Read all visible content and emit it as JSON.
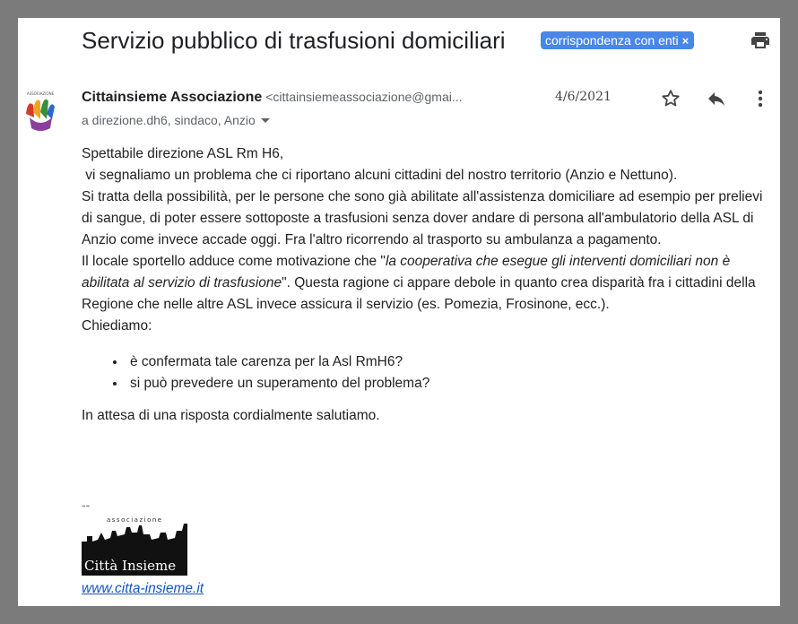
{
  "email": {
    "subject": "Servizio pubblico di trasfusioni domiciliari",
    "label": "corrispondenza con enti",
    "label_remove": "×",
    "sender_name": "Cittainsieme Associazione",
    "sender_email": "<cittainsiemeassociazione@gmai...",
    "date": "4/6/2021",
    "recipients": "a direzione.dh6, sindaco, Anzio",
    "body": {
      "greeting": "Spettabile direzione ASL Rm H6,",
      "line1": " vi segnaliamo un problema che ci riportano alcuni cittadini del nostro territorio (Anzio e Nettuno).",
      "para1": "Si tratta della possibilità, per le persone che sono già abilitate all'assistenza domiciliare ad esempio per prelievi di sangue, di poter essere sottoposte a trasfusioni senza dover andare di persona all'ambulatorio della ASL di Anzio come invece accade oggi. Fra l'altro ricorrendo al trasporto su ambulanza a pagamento.",
      "para2_pre": "Il locale sportello adduce come motivazione che \"",
      "para2_italic": "la cooperativa che esegue gli interventi domiciliari non è abilitata al servizio di trasfusione",
      "para2_post": "\". Questa ragione ci appare debole in quanto crea disparità fra i cittadini della Regione che nelle altre ASL invece assicura il servizio (es. Pomezia, Frosinone, ecc.).",
      "ask": "Chiediamo:",
      "questions": [
        "è confermata tale carenza per la Asl RmH6?",
        "si può prevedere un superamento del problema?"
      ],
      "closing": "In attesa di una risposta cordialmente salutiamo."
    },
    "signature": {
      "dash": "--",
      "logo_top": "associazione",
      "logo_text": "Città Insieme",
      "link": "www.citta-insieme.it"
    }
  },
  "colors": {
    "label_bg": "#4a86e8",
    "link": "#1155cc",
    "background": "#7b7b7b"
  },
  "icons": [
    "print-icon",
    "star-icon",
    "reply-icon",
    "more-vert-icon",
    "chevron-down-icon"
  ]
}
